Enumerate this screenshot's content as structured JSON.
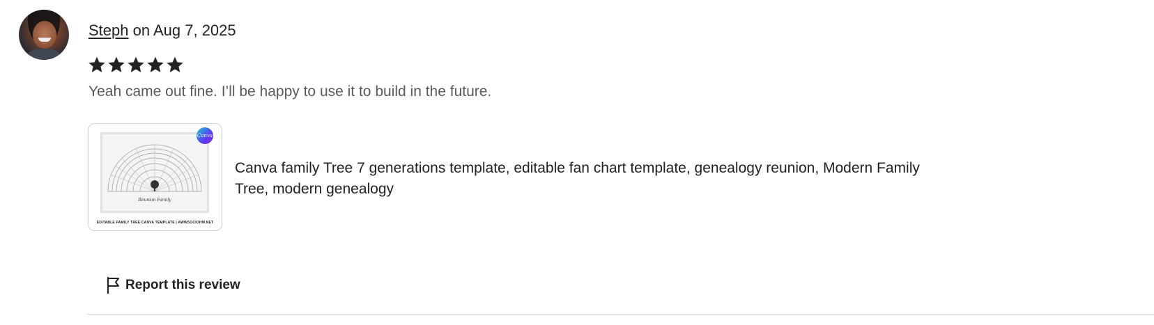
{
  "review": {
    "reviewer_name": "Steph",
    "date_text": " on Aug 7, 2025",
    "rating": 5,
    "rating_max": 5,
    "text": "Yeah came out fine. I’ll be happy to use it to build in the future."
  },
  "listing": {
    "title": "Canva family Tree 7 generations template, editable fan chart template, genealogy reunion, Modern Family Tree, modern genealogy",
    "badge_text": "Canva",
    "thumbnail_caption": "EDITABLE FAMILY TREE CANVA TEMPLATE | AWWSOCIOHM.NET",
    "thumbnail_family_text": "Reunion Family"
  },
  "actions": {
    "report_label": "Report this review"
  },
  "colors": {
    "star": "#222222",
    "text_primary": "#222222",
    "text_secondary": "#595959",
    "divider": "#d9d9d9",
    "canva_badge": "#5b3cf0"
  },
  "icons": {
    "report": "flag-icon",
    "rating": "star-icon"
  }
}
